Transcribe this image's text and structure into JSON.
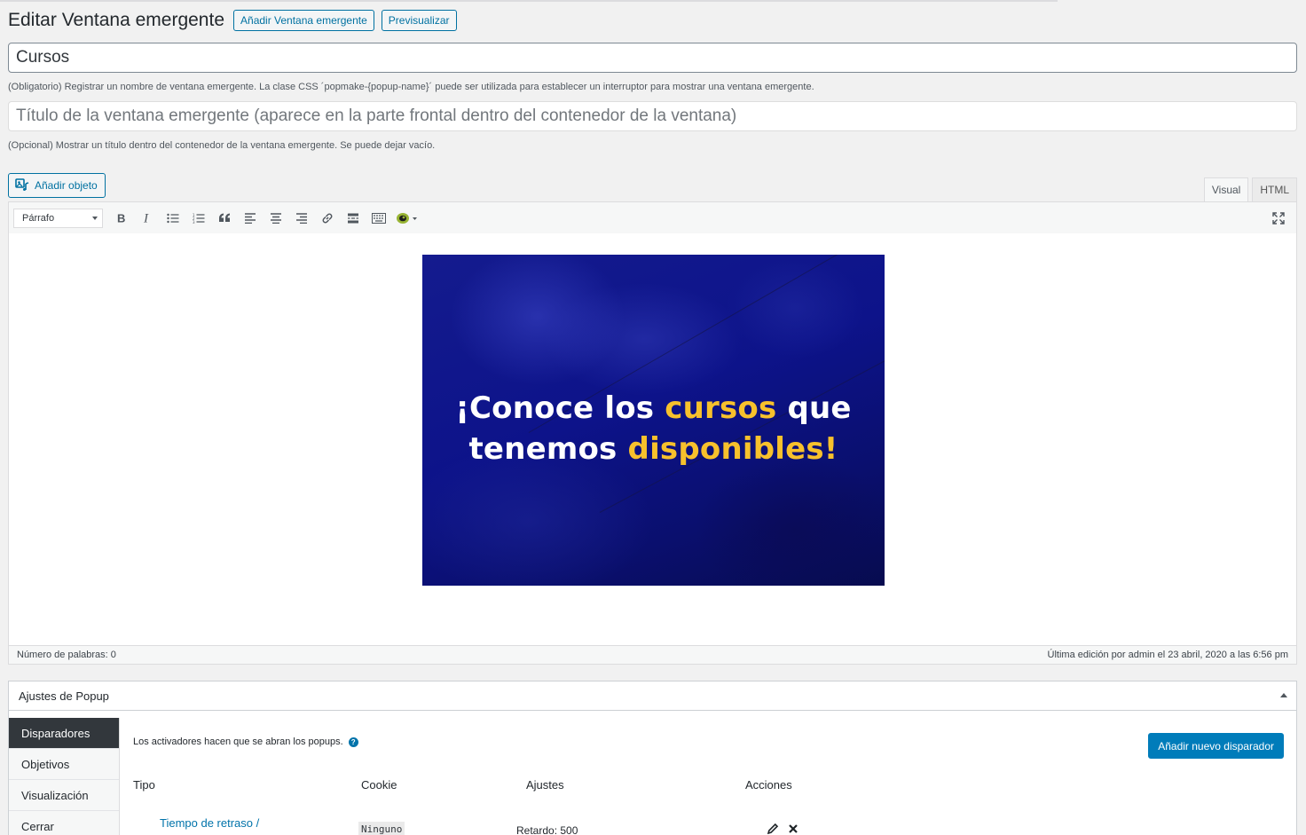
{
  "header": {
    "title": "Editar Ventana emergente",
    "add_new_label": "Añadir Ventana emergente",
    "preview_label": "Previsualizar"
  },
  "name_field": {
    "value": "Cursos",
    "help": "(Obligatorio) Registrar un nombre de ventana emergente. La clase CSS ´popmake-{popup-name}´ puede ser utilizada para establecer un interruptor para mostrar una ventana emergente."
  },
  "title_field": {
    "placeholder": "Título de la ventana emergente (aparece en la parte frontal dentro del contenedor de la ventana)",
    "help": "(Opcional) Mostrar un título dentro del contenedor de la ventana emergente. Se puede dejar vacío."
  },
  "editor": {
    "add_media_label": "Añadir objeto",
    "tabs": {
      "visual": "Visual",
      "html": "HTML",
      "active": "visual"
    },
    "format_select": "Párrafo",
    "toolbar_icons": [
      "bold-icon",
      "italic-icon",
      "bulleted-list-icon",
      "numbered-list-icon",
      "blockquote-icon",
      "align-left-icon",
      "align-center-icon",
      "align-right-icon",
      "link-icon",
      "read-more-icon",
      "toolbar-toggle-icon",
      "popup-maker-icon",
      "fullscreen-icon"
    ],
    "banner": {
      "line1_a": "¡Conoce los ",
      "line1_b": "cursos",
      "line1_c": " que",
      "line2_a": "tenemos ",
      "line2_b": "disponibles!",
      "bg_color": "#0d138a",
      "highlight_color": "#f7c12c"
    },
    "word_count": "Número de palabras: 0",
    "last_edit": "Última edición por admin el 23 abril, 2020 a las 6:56 pm"
  },
  "settings": {
    "title": "Ajustes de Popup",
    "tabs": [
      "Disparadores",
      "Objetivos",
      "Visualización",
      "Cerrar"
    ],
    "active_tab": "Disparadores",
    "intro": "Los activadores hacen que se abran los popups.",
    "add_trigger_label": "Añadir nuevo disparador",
    "columns": [
      "Tipo",
      "Cookie",
      "Ajustes",
      "Acciones"
    ],
    "rows": [
      {
        "type": "Tiempo de retraso /",
        "cookie": "Ninguno",
        "settings": "Retardo: 500"
      }
    ],
    "accent_color": "#007cba"
  }
}
